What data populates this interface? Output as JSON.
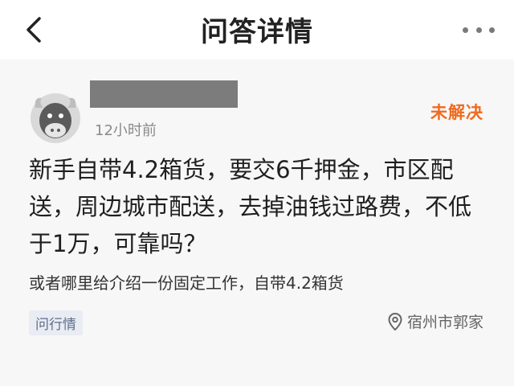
{
  "header": {
    "title": "问答详情",
    "back_icon": "chevron-left-icon",
    "more_icon": "more-dots-icon"
  },
  "post": {
    "avatar_icon": "bull-avatar-icon",
    "time": "12小时前",
    "status": "未解决",
    "question": "新手自带4.2箱货，要交6千押金，市区配送，周边城市配送，去掉油钱过路费，不低于1万，可靠吗？",
    "detail": "或者哪里给介绍一份固定工作，自带4.2箱货",
    "tag": "问行情",
    "location": "宿州市郭家",
    "location_icon": "location-pin-icon"
  },
  "colors": {
    "status": "#f06a1e",
    "tag_bg": "#e9ecf3",
    "tag_text": "#5f6f8c",
    "card_bg": "#f7f7f7"
  }
}
